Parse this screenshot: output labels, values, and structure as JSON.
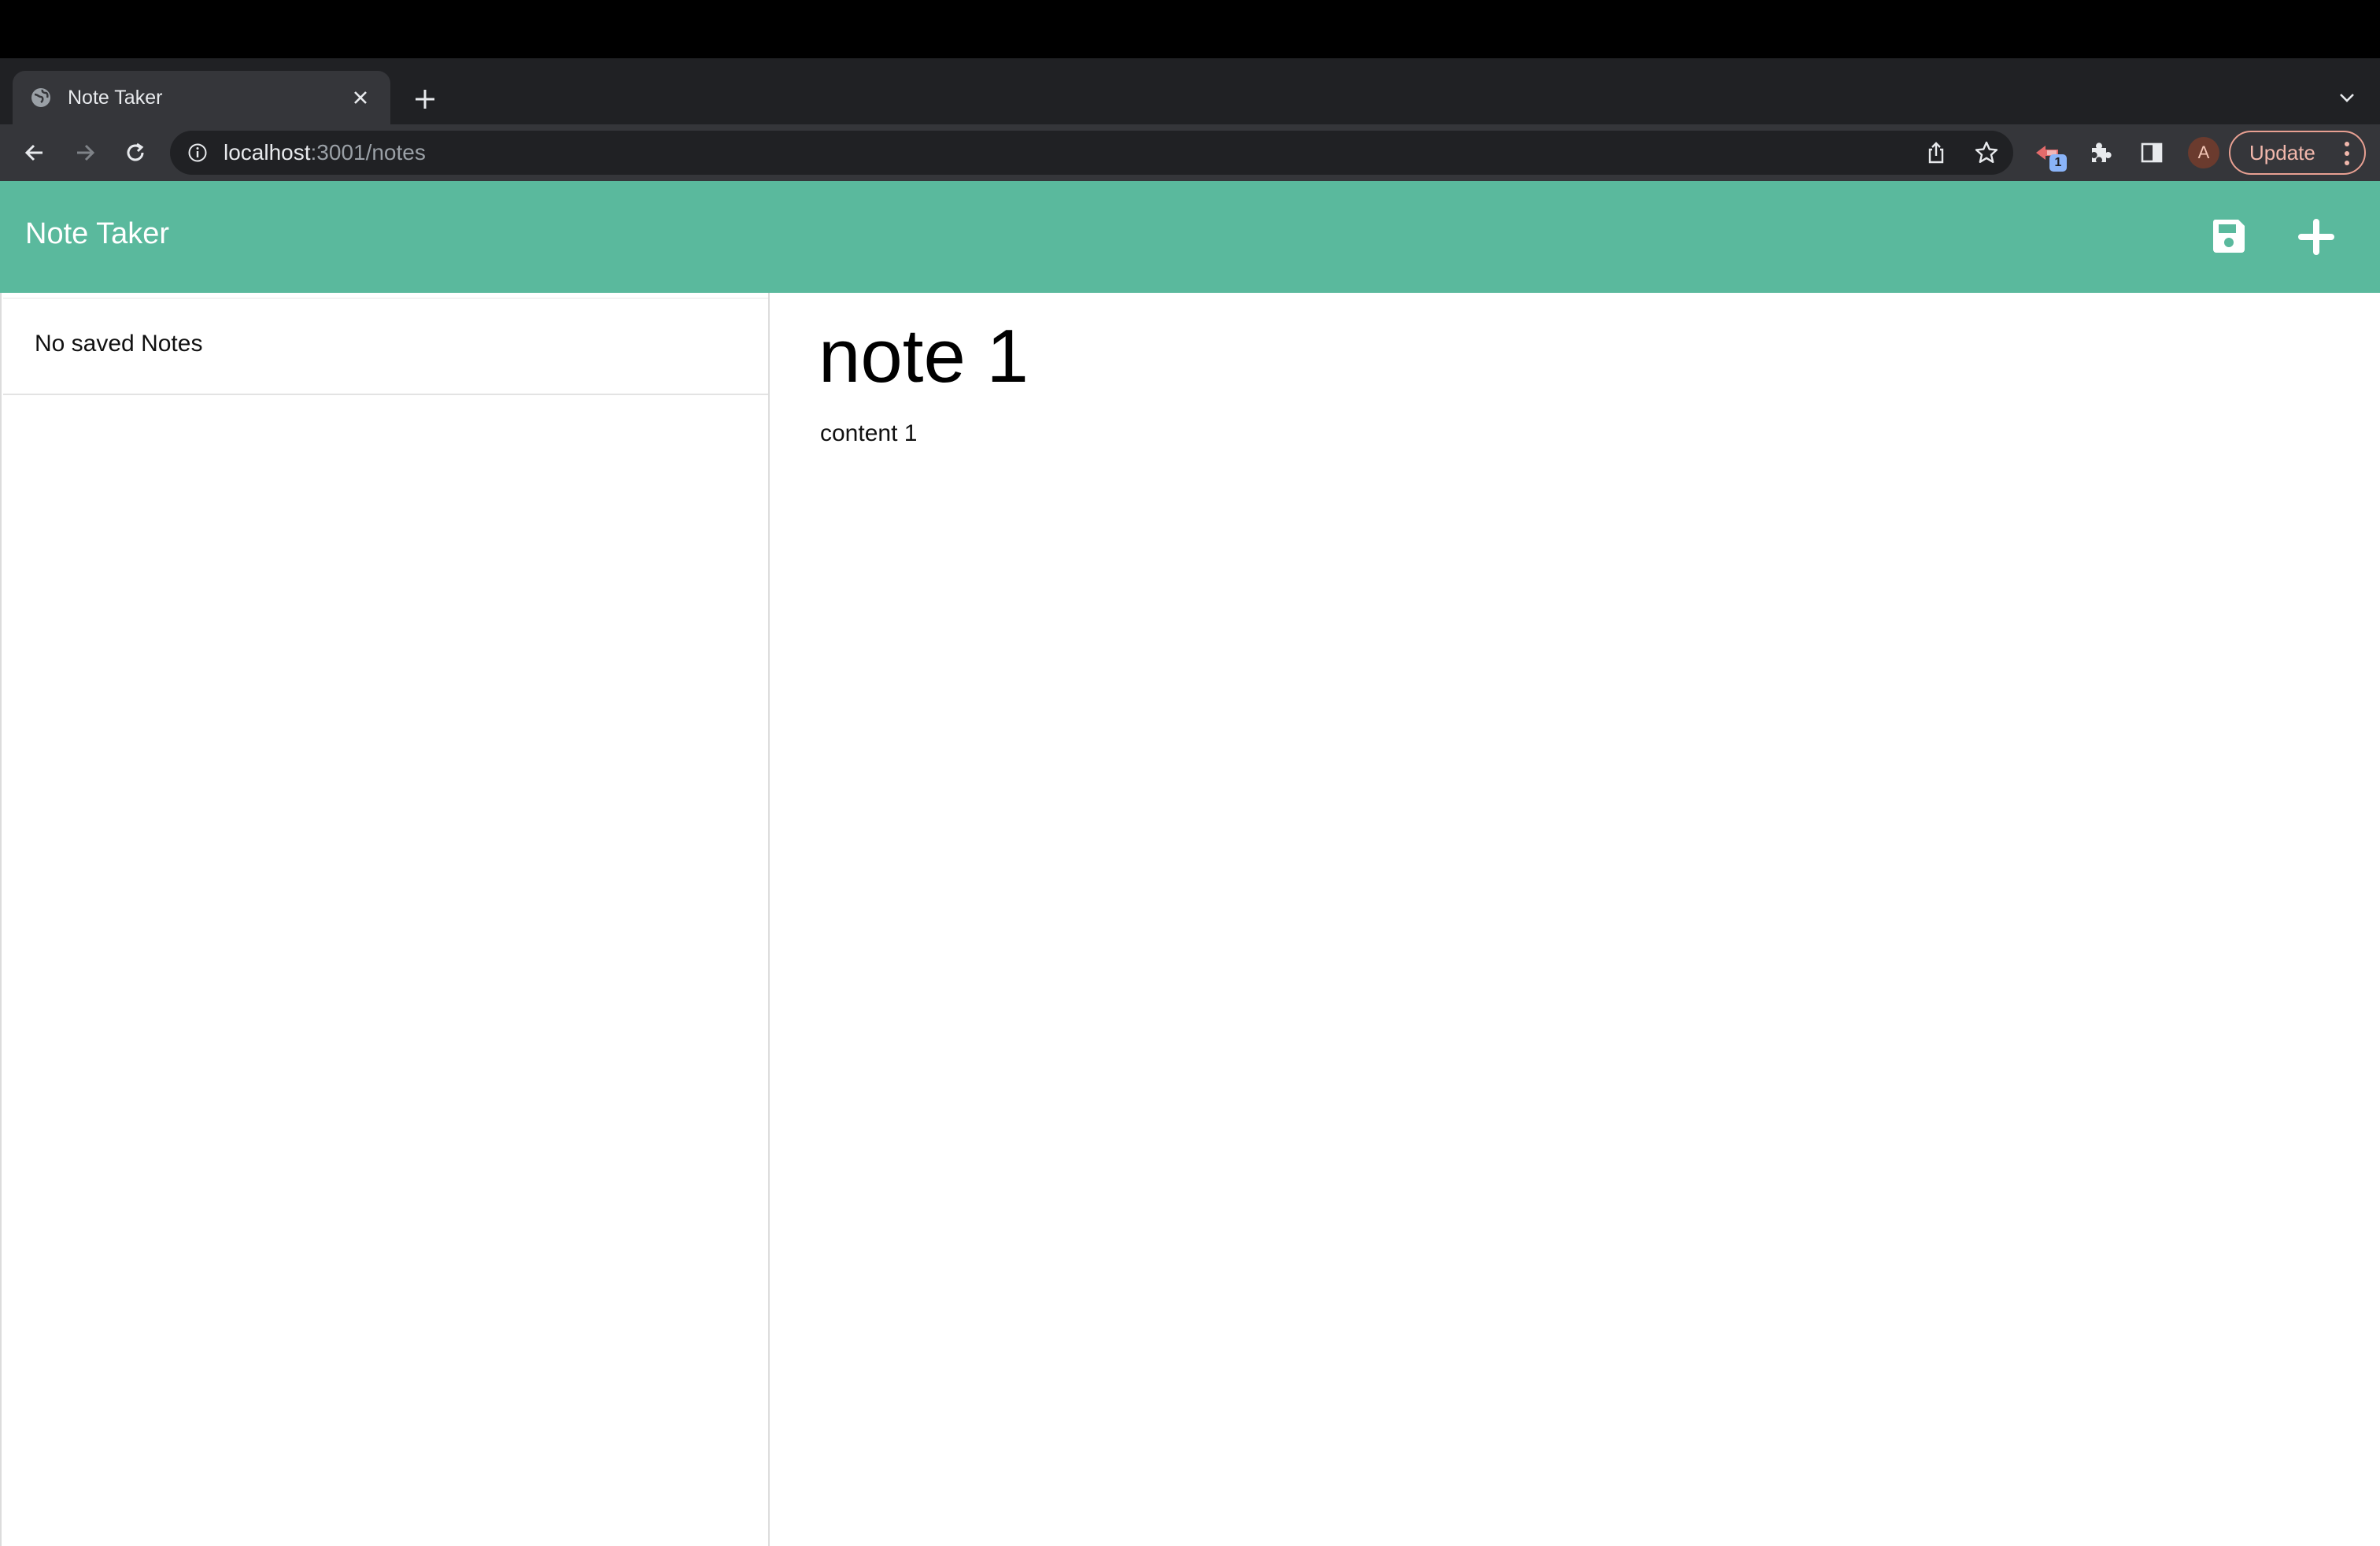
{
  "browser": {
    "tab": {
      "title": "Note Taker"
    },
    "url": {
      "host": "localhost",
      "rest": ":3001/notes"
    },
    "extension_badge": "1",
    "avatar_initial": "A",
    "update_label": "Update"
  },
  "app": {
    "title": "Note Taker",
    "accent_color": "#5ab99d",
    "sidebar": {
      "empty_message": "No saved Notes"
    },
    "editor": {
      "title": "note 1",
      "text": "content 1"
    },
    "icons": {
      "save": "save-icon",
      "add": "plus-icon"
    }
  }
}
